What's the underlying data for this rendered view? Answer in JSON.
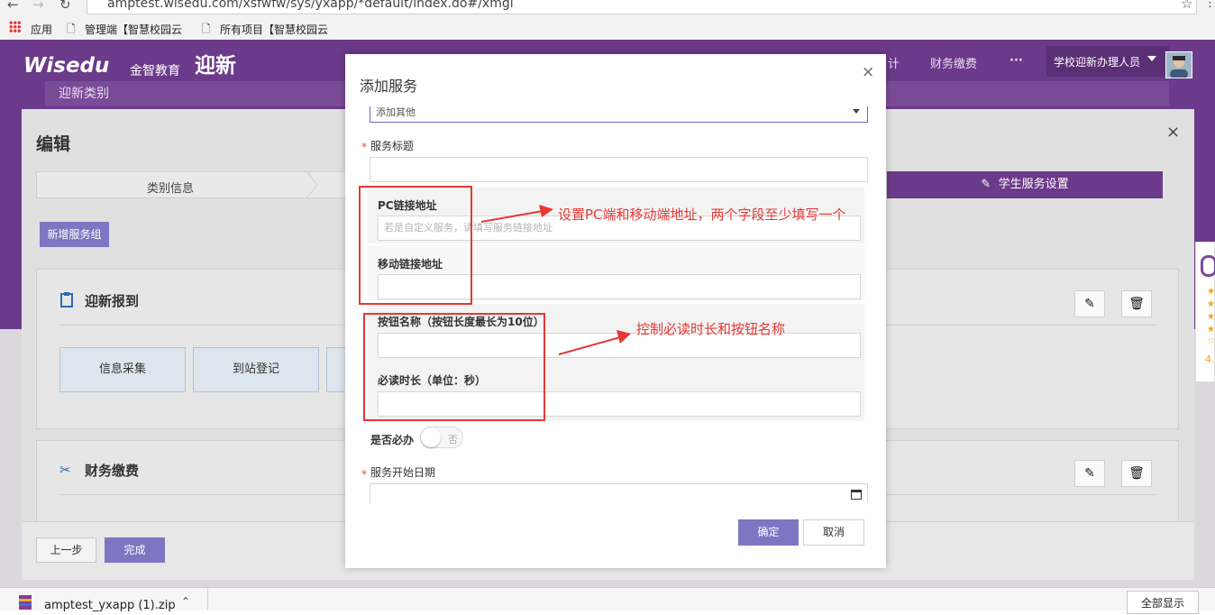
{
  "browser": {
    "url": "amptest.wisedu.com/xsfwfw/sys/yxapp/*default/index.do#/xmgl",
    "bookmarks": [
      "应用",
      "管理端【智慧校园云",
      "所有项目【智慧校园云"
    ]
  },
  "header": {
    "logo_text": "Wisedu",
    "logo_cn": "金智教育",
    "app_title": "迎新",
    "nav_items": [
      "计",
      "财务缴费",
      "···"
    ],
    "user_name": "学校迎新办理人员",
    "category_tab": "迎新类别"
  },
  "edit_panel": {
    "title": "编辑",
    "close_glyph": "×",
    "steps": [
      "类别信息",
      "学生服务设置"
    ],
    "add_group_label": "新增服务组",
    "groups": [
      {
        "title": "迎新报到",
        "tiles": [
          "信息采集",
          "到站登记"
        ]
      },
      {
        "title": "财务缴费",
        "tiles": []
      }
    ],
    "prev_label": "上一步",
    "done_label": "完成"
  },
  "side_widget": {
    "rating_text": "4."
  },
  "modal": {
    "title": "添加服务",
    "close_glyph": "×",
    "select_value": "添加其他",
    "required_mark": "*",
    "fields": {
      "service_title": {
        "label": "服务标题",
        "value": ""
      },
      "pc_link": {
        "label": "PC链接地址",
        "placeholder": "若是自定义服务，请填写服务链接地址"
      },
      "mobile_link": {
        "label": "移动链接地址",
        "value": ""
      },
      "button_name": {
        "label": "按钮名称（按钮长度最长为10位）",
        "value": ""
      },
      "read_duration": {
        "label": "必读时长（单位：秒）",
        "value": ""
      },
      "must_do": {
        "label": "是否必办",
        "toggle_text": "否",
        "on": false
      },
      "start_date": {
        "label": "服务开始日期",
        "value": ""
      }
    },
    "ok_label": "确定",
    "cancel_label": "取消"
  },
  "annotations": [
    "设置PC端和移动端地址，两个字段至少填写一个",
    "控制必读时长和按钮名称"
  ],
  "download_bar": {
    "file_name": "amptest_yxapp (1).zip",
    "show_all_label": "全部显示"
  },
  "colors": {
    "brand_purple": "#6b3a8a",
    "button_purple": "#7d76c2",
    "annotation_red": "#e53935"
  }
}
